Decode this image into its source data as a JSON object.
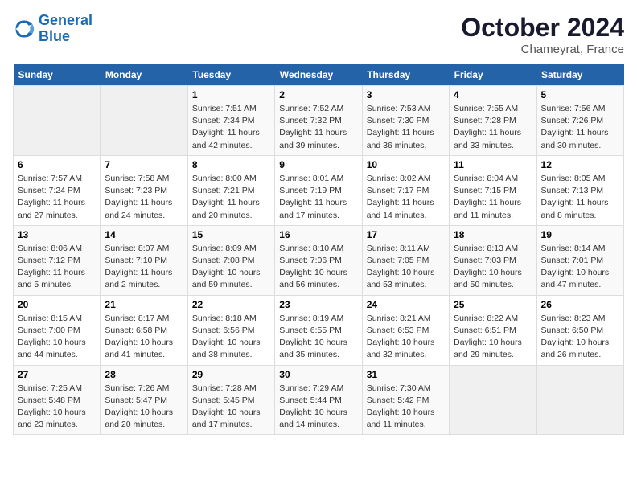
{
  "logo": {
    "line1": "General",
    "line2": "Blue"
  },
  "header": {
    "month_title": "October 2024",
    "location": "Chameyrat, France"
  },
  "days_of_week": [
    "Sunday",
    "Monday",
    "Tuesday",
    "Wednesday",
    "Thursday",
    "Friday",
    "Saturday"
  ],
  "weeks": [
    [
      {
        "day": "",
        "info": ""
      },
      {
        "day": "",
        "info": ""
      },
      {
        "day": "1",
        "info": "Sunrise: 7:51 AM\nSunset: 7:34 PM\nDaylight: 11 hours and 42 minutes."
      },
      {
        "day": "2",
        "info": "Sunrise: 7:52 AM\nSunset: 7:32 PM\nDaylight: 11 hours and 39 minutes."
      },
      {
        "day": "3",
        "info": "Sunrise: 7:53 AM\nSunset: 7:30 PM\nDaylight: 11 hours and 36 minutes."
      },
      {
        "day": "4",
        "info": "Sunrise: 7:55 AM\nSunset: 7:28 PM\nDaylight: 11 hours and 33 minutes."
      },
      {
        "day": "5",
        "info": "Sunrise: 7:56 AM\nSunset: 7:26 PM\nDaylight: 11 hours and 30 minutes."
      }
    ],
    [
      {
        "day": "6",
        "info": "Sunrise: 7:57 AM\nSunset: 7:24 PM\nDaylight: 11 hours and 27 minutes."
      },
      {
        "day": "7",
        "info": "Sunrise: 7:58 AM\nSunset: 7:23 PM\nDaylight: 11 hours and 24 minutes."
      },
      {
        "day": "8",
        "info": "Sunrise: 8:00 AM\nSunset: 7:21 PM\nDaylight: 11 hours and 20 minutes."
      },
      {
        "day": "9",
        "info": "Sunrise: 8:01 AM\nSunset: 7:19 PM\nDaylight: 11 hours and 17 minutes."
      },
      {
        "day": "10",
        "info": "Sunrise: 8:02 AM\nSunset: 7:17 PM\nDaylight: 11 hours and 14 minutes."
      },
      {
        "day": "11",
        "info": "Sunrise: 8:04 AM\nSunset: 7:15 PM\nDaylight: 11 hours and 11 minutes."
      },
      {
        "day": "12",
        "info": "Sunrise: 8:05 AM\nSunset: 7:13 PM\nDaylight: 11 hours and 8 minutes."
      }
    ],
    [
      {
        "day": "13",
        "info": "Sunrise: 8:06 AM\nSunset: 7:12 PM\nDaylight: 11 hours and 5 minutes."
      },
      {
        "day": "14",
        "info": "Sunrise: 8:07 AM\nSunset: 7:10 PM\nDaylight: 11 hours and 2 minutes."
      },
      {
        "day": "15",
        "info": "Sunrise: 8:09 AM\nSunset: 7:08 PM\nDaylight: 10 hours and 59 minutes."
      },
      {
        "day": "16",
        "info": "Sunrise: 8:10 AM\nSunset: 7:06 PM\nDaylight: 10 hours and 56 minutes."
      },
      {
        "day": "17",
        "info": "Sunrise: 8:11 AM\nSunset: 7:05 PM\nDaylight: 10 hours and 53 minutes."
      },
      {
        "day": "18",
        "info": "Sunrise: 8:13 AM\nSunset: 7:03 PM\nDaylight: 10 hours and 50 minutes."
      },
      {
        "day": "19",
        "info": "Sunrise: 8:14 AM\nSunset: 7:01 PM\nDaylight: 10 hours and 47 minutes."
      }
    ],
    [
      {
        "day": "20",
        "info": "Sunrise: 8:15 AM\nSunset: 7:00 PM\nDaylight: 10 hours and 44 minutes."
      },
      {
        "day": "21",
        "info": "Sunrise: 8:17 AM\nSunset: 6:58 PM\nDaylight: 10 hours and 41 minutes."
      },
      {
        "day": "22",
        "info": "Sunrise: 8:18 AM\nSunset: 6:56 PM\nDaylight: 10 hours and 38 minutes."
      },
      {
        "day": "23",
        "info": "Sunrise: 8:19 AM\nSunset: 6:55 PM\nDaylight: 10 hours and 35 minutes."
      },
      {
        "day": "24",
        "info": "Sunrise: 8:21 AM\nSunset: 6:53 PM\nDaylight: 10 hours and 32 minutes."
      },
      {
        "day": "25",
        "info": "Sunrise: 8:22 AM\nSunset: 6:51 PM\nDaylight: 10 hours and 29 minutes."
      },
      {
        "day": "26",
        "info": "Sunrise: 8:23 AM\nSunset: 6:50 PM\nDaylight: 10 hours and 26 minutes."
      }
    ],
    [
      {
        "day": "27",
        "info": "Sunrise: 7:25 AM\nSunset: 5:48 PM\nDaylight: 10 hours and 23 minutes."
      },
      {
        "day": "28",
        "info": "Sunrise: 7:26 AM\nSunset: 5:47 PM\nDaylight: 10 hours and 20 minutes."
      },
      {
        "day": "29",
        "info": "Sunrise: 7:28 AM\nSunset: 5:45 PM\nDaylight: 10 hours and 17 minutes."
      },
      {
        "day": "30",
        "info": "Sunrise: 7:29 AM\nSunset: 5:44 PM\nDaylight: 10 hours and 14 minutes."
      },
      {
        "day": "31",
        "info": "Sunrise: 7:30 AM\nSunset: 5:42 PM\nDaylight: 10 hours and 11 minutes."
      },
      {
        "day": "",
        "info": ""
      },
      {
        "day": "",
        "info": ""
      }
    ]
  ]
}
